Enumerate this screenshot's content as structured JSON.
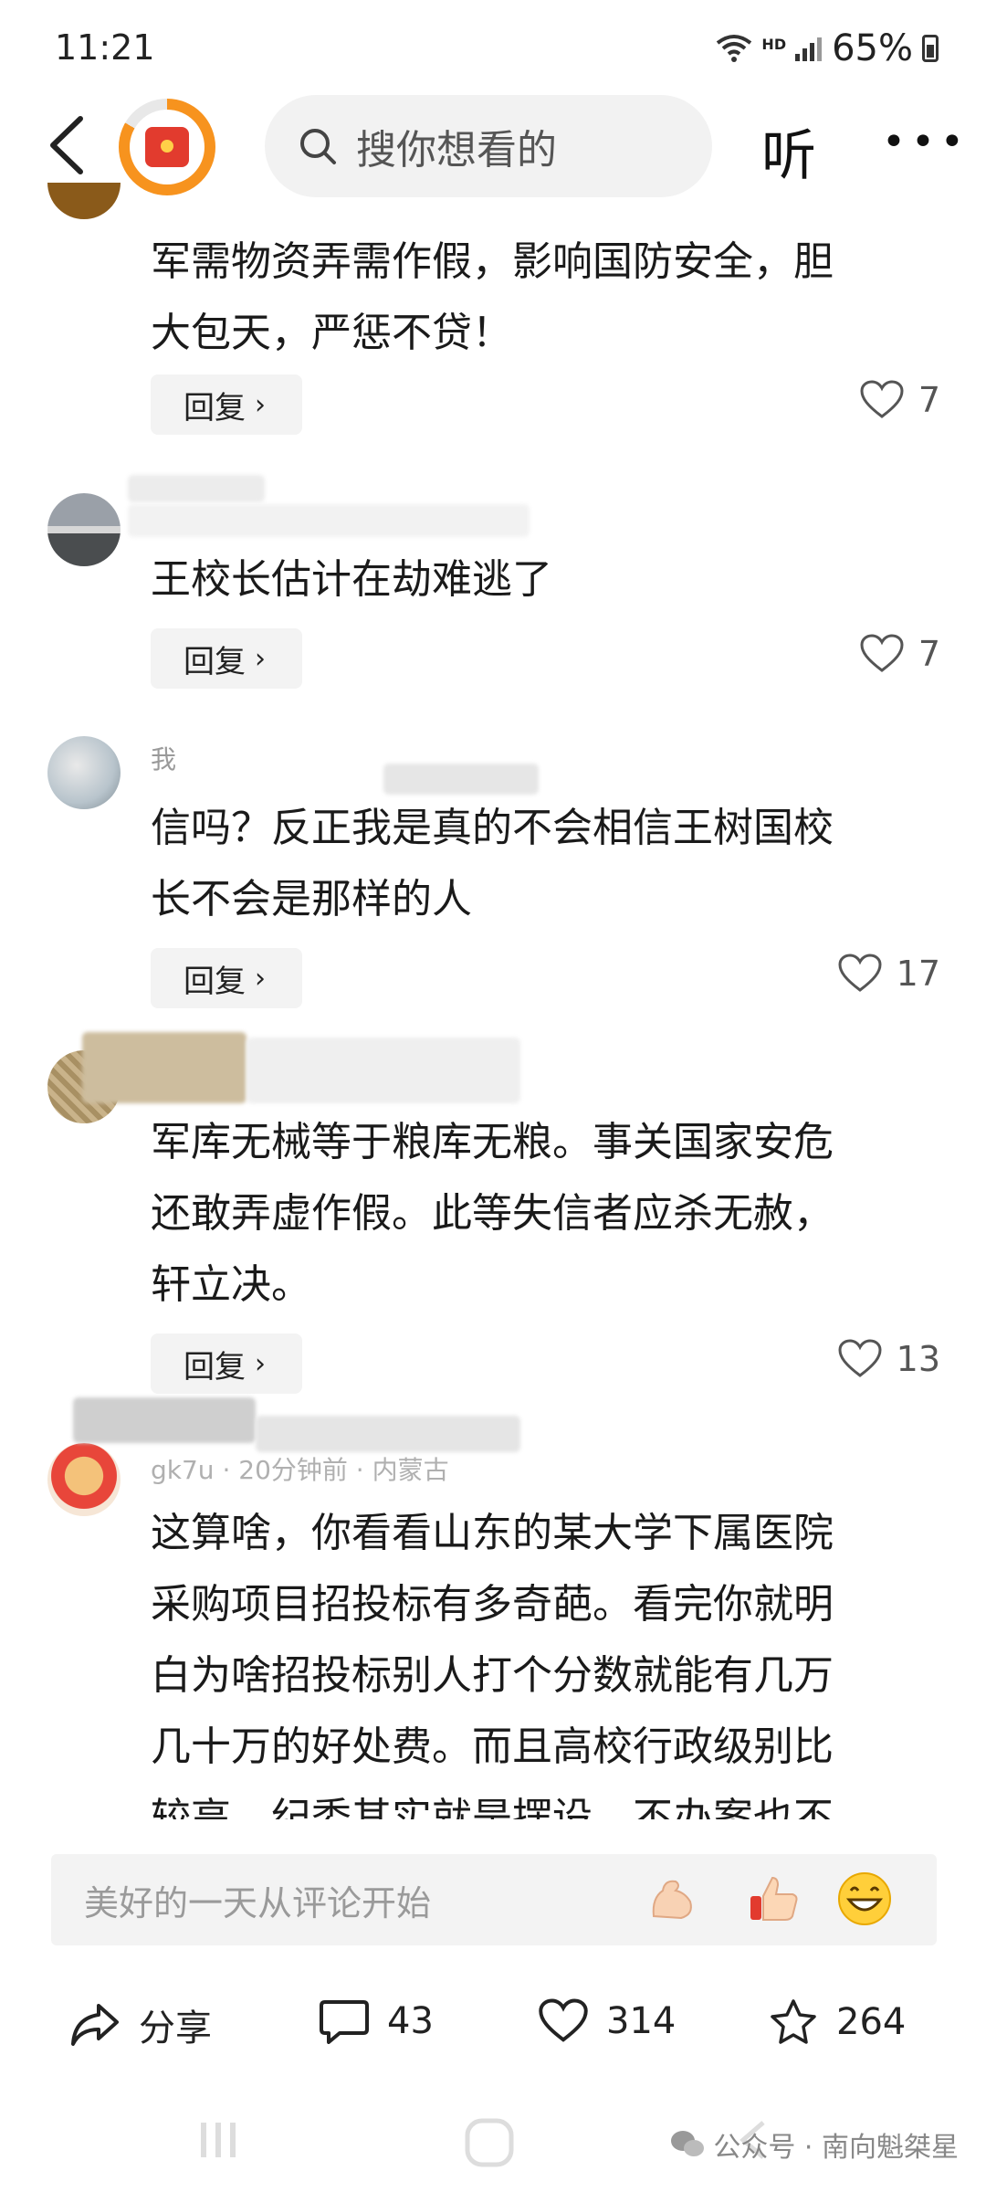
{
  "status": {
    "time": "11:21",
    "network": "HD",
    "battery": "65%"
  },
  "header": {
    "search_placeholder": "搜你想看的",
    "listen_label": "听",
    "more_label": "•••"
  },
  "comments": [
    {
      "text_lines": [
        "军需物资弄需作假，影响国防安全，胆",
        "大包天，严惩不贷！"
      ],
      "likes": "7",
      "reply": "回复"
    },
    {
      "meta": "",
      "text_lines": [
        "王校长估计在劫难逃了"
      ],
      "likes": "7",
      "reply": "回复"
    },
    {
      "meta": "我",
      "text_lines": [
        "信吗？反正我是真的不会相信王树国校",
        "长不会是那样的人"
      ],
      "likes": "17",
      "reply": "回复"
    },
    {
      "text_lines": [
        "军库无械等于粮库无粮。事关国家安危",
        "还敢弄虚作假。此等失信者应杀无赦，",
        "轩立决。"
      ],
      "likes": "13",
      "reply": "回复"
    },
    {
      "meta": "gk7u · 20分钟前 · 内蒙古",
      "text_lines": [
        "这算啥，你看看山东的某大学下属医院",
        "采购项目招投标有多奇葩。看完你就明",
        "白为啥招投标别人打个分数就能有几万",
        "几十万的好处费。而且高校行政级别比",
        "较高，纪委其实就是摆设，不办案也不"
      ]
    }
  ],
  "input": {
    "placeholder": "美好的一天从评论开始"
  },
  "actions": {
    "share": "分享",
    "comments": "43",
    "likes": "314",
    "favorites": "264"
  },
  "watermark": "公众号 · 南向魁桀星",
  "colors": {
    "accent": "#f7931e",
    "red_packet": "#e23b2e"
  }
}
